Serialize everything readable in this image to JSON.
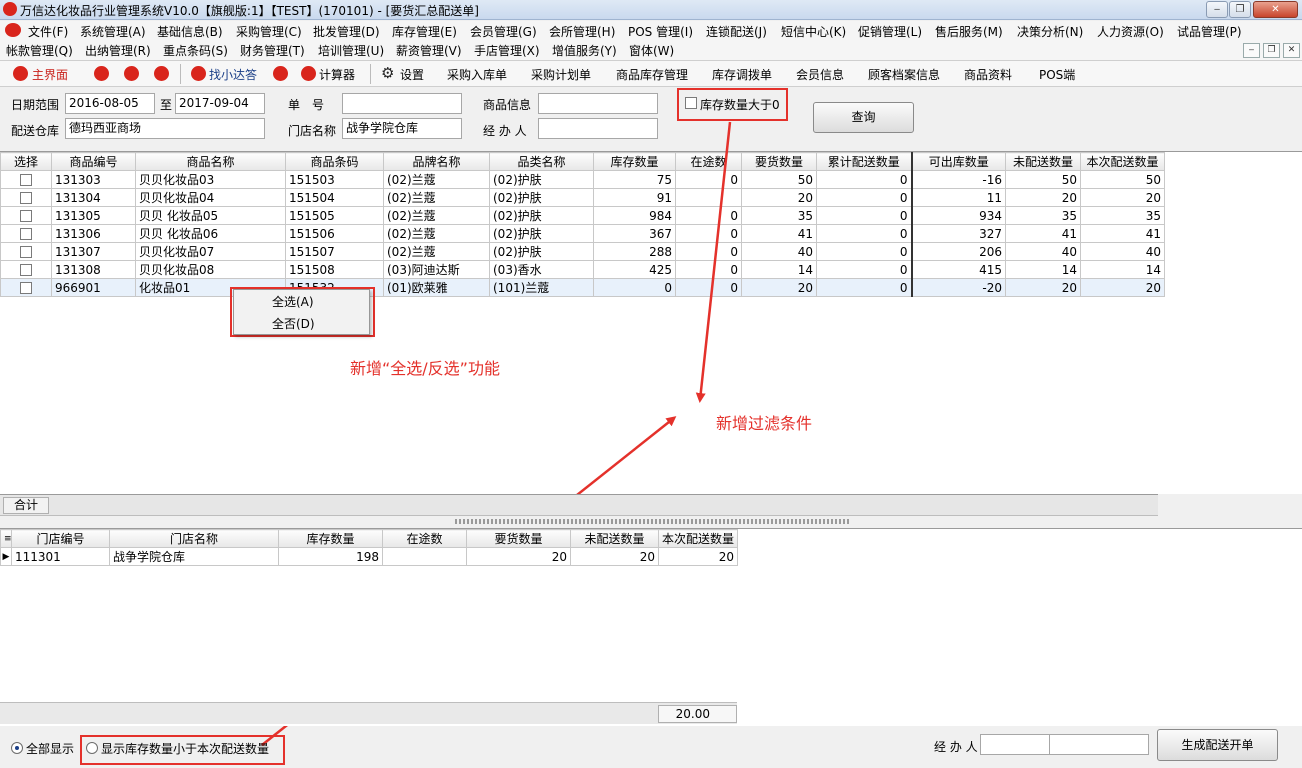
{
  "window": {
    "title": "万信达化妆品行业管理系统V10.0【旗舰版:1】【TEST】(170101) - [要货汇总配送单]"
  },
  "menus": {
    "row1": [
      "文件(F)",
      "系统管理(A)",
      "基础信息(B)",
      "采购管理(C)",
      "批发管理(D)",
      "库存管理(E)",
      "会员管理(G)",
      "会所管理(H)",
      "POS 管理(I)",
      "连锁配送(J)",
      "短信中心(K)",
      "促销管理(L)",
      "售后服务(M)",
      "决策分析(N)",
      "人力资源(O)",
      "试品管理(P)"
    ],
    "row2": [
      "帐款管理(Q)",
      "出纳管理(R)",
      "重点条码(S)",
      "财务管理(T)",
      "培训管理(U)",
      "薪资管理(V)",
      "手店管理(X)",
      "增值服务(Y)",
      "窗体(W)"
    ]
  },
  "toolbar": {
    "home": "主界面",
    "find": "找小达答",
    "calc": "计算器",
    "settings": "设置",
    "items": [
      "采购入库单",
      "采购计划单",
      "商品库存管理",
      "库存调拨单",
      "会员信息",
      "顾客档案信息",
      "商品资料",
      "POS端"
    ]
  },
  "filters": {
    "date_label": "日期范围",
    "date_from": "2016-08-05",
    "to_label": "至",
    "date_to": "2017-09-04",
    "order_no_label": "单　号",
    "order_no": "",
    "goods_label": "商品信息",
    "goods": "",
    "stock_gt_label": "库存数量大于0",
    "warehouse_label": "配送仓库",
    "warehouse": "德玛西亚商场",
    "store_label": "门店名称",
    "store": "战争学院仓库",
    "handler_label": "经 办 人",
    "handler": "",
    "query_button": "查询"
  },
  "main_table": {
    "headers": [
      "选择",
      "商品编号",
      "商品名称",
      "商品条码",
      "品牌名称",
      "品类名称",
      "库存数量",
      "在途数",
      "要货数量",
      "累计配送数量",
      "可出库数量",
      "未配送数量",
      "本次配送数量"
    ],
    "rows": [
      [
        "",
        "131303",
        "贝贝化妆品03",
        "151503",
        "(02)兰蔻",
        "(02)护肤",
        "75",
        "0",
        "50",
        "0",
        "-16",
        "50",
        "50"
      ],
      [
        "",
        "131304",
        "贝贝化妆品04",
        "151504",
        "(02)兰蔻",
        "(02)护肤",
        "91",
        "",
        "20",
        "0",
        "11",
        "20",
        "20"
      ],
      [
        "",
        "131305",
        "贝贝 化妆品05",
        "151505",
        "(02)兰蔻",
        "(02)护肤",
        "984",
        "0",
        "35",
        "0",
        "934",
        "35",
        "35"
      ],
      [
        "",
        "131306",
        "贝贝 化妆品06",
        "151506",
        "(02)兰蔻",
        "(02)护肤",
        "367",
        "0",
        "41",
        "0",
        "327",
        "41",
        "41"
      ],
      [
        "",
        "131307",
        "贝贝化妆品07",
        "151507",
        "(02)兰蔻",
        "(02)护肤",
        "288",
        "0",
        "40",
        "0",
        "206",
        "40",
        "40"
      ],
      [
        "",
        "131308",
        "贝贝化妆品08",
        "151508",
        "(03)阿迪达斯",
        "(03)香水",
        "425",
        "0",
        "14",
        "0",
        "415",
        "14",
        "14"
      ],
      [
        "",
        "966901",
        "化妆品01",
        "151532",
        "(01)欧莱雅",
        "(101)兰蔻",
        "0",
        "0",
        "20",
        "0",
        "-20",
        "20",
        "20"
      ]
    ]
  },
  "context_menu": {
    "select_all": "全选(A)",
    "select_none": "全否(D)"
  },
  "annotations": {
    "select_all": "新增“全选/反选”功能",
    "filter": "新增过滤条件"
  },
  "summary": {
    "total_label": "合计"
  },
  "detail_table": {
    "headers": [
      "门店编号",
      "门店名称",
      "库存数量",
      "在途数",
      "要货数量",
      "未配送数量",
      "本次配送数量"
    ],
    "rows": [
      [
        "111301",
        "战争学院仓库",
        "198",
        "",
        "20",
        "20",
        "20"
      ]
    ],
    "footer_total": "20.00"
  },
  "bottom": {
    "show_all": "全部显示",
    "show_less": "显示库存数量小于本次配送数量",
    "handler_label": "经 办 人",
    "generate_button": "生成配送开单"
  },
  "colors": {
    "annotation": "#e4312b",
    "brand": "#d9251c"
  }
}
